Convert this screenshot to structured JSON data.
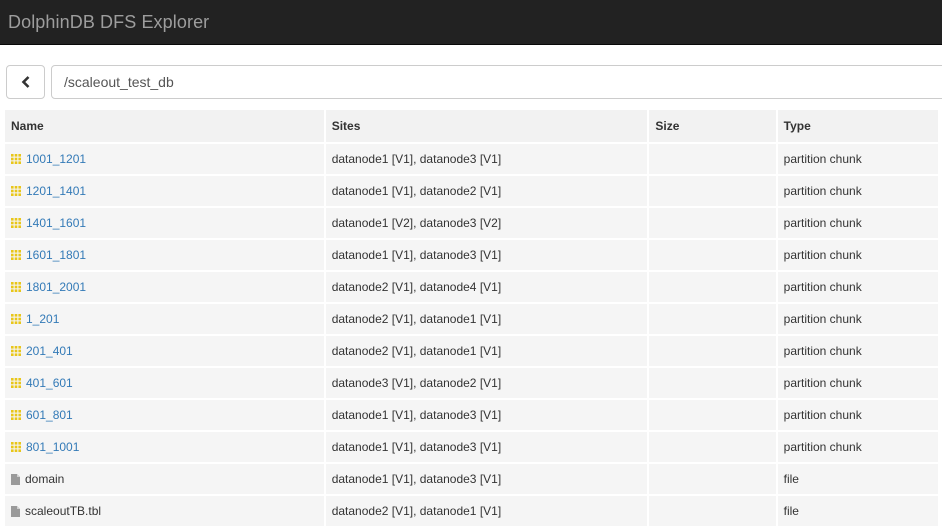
{
  "app": {
    "title": "DolphinDB DFS Explorer"
  },
  "path": {
    "value": "/scaleout_test_db"
  },
  "table": {
    "headers": {
      "name": "Name",
      "sites": "Sites",
      "size": "Size",
      "type": "Type"
    },
    "rows": [
      {
        "name": "1001_1201",
        "sites": "datanode1 [V1], datanode3 [V1]",
        "size": "",
        "type": "partition chunk",
        "icon": "grid-icon"
      },
      {
        "name": "1201_1401",
        "sites": "datanode1 [V1], datanode2 [V1]",
        "size": "",
        "type": "partition chunk",
        "icon": "grid-icon"
      },
      {
        "name": "1401_1601",
        "sites": "datanode1 [V2], datanode3 [V2]",
        "size": "",
        "type": "partition chunk",
        "icon": "grid-icon"
      },
      {
        "name": "1601_1801",
        "sites": "datanode1 [V1], datanode3 [V1]",
        "size": "",
        "type": "partition chunk",
        "icon": "grid-icon"
      },
      {
        "name": "1801_2001",
        "sites": "datanode2 [V1], datanode4 [V1]",
        "size": "",
        "type": "partition chunk",
        "icon": "grid-icon"
      },
      {
        "name": "1_201",
        "sites": "datanode2 [V1], datanode1 [V1]",
        "size": "",
        "type": "partition chunk",
        "icon": "grid-icon"
      },
      {
        "name": "201_401",
        "sites": "datanode2 [V1], datanode1 [V1]",
        "size": "",
        "type": "partition chunk",
        "icon": "grid-icon"
      },
      {
        "name": "401_601",
        "sites": "datanode3 [V1], datanode2 [V1]",
        "size": "",
        "type": "partition chunk",
        "icon": "grid-icon"
      },
      {
        "name": "601_801",
        "sites": "datanode1 [V1], datanode3 [V1]",
        "size": "",
        "type": "partition chunk",
        "icon": "grid-icon"
      },
      {
        "name": "801_1001",
        "sites": "datanode1 [V1], datanode3 [V1]",
        "size": "",
        "type": "partition chunk",
        "icon": "grid-icon"
      },
      {
        "name": "domain",
        "sites": "datanode1 [V1], datanode3 [V1]",
        "size": "",
        "type": "file",
        "icon": "file-icon"
      },
      {
        "name": "scaleoutTB.tbl",
        "sites": "datanode2 [V1], datanode1 [V1]",
        "size": "",
        "type": "file",
        "icon": "file-icon"
      }
    ]
  },
  "colors": {
    "navbar": "#222222",
    "title": "#9d9d9d",
    "link": "#337ab7",
    "grid_icon": "#e8c61a",
    "file_icon": "#9a9a9a"
  }
}
